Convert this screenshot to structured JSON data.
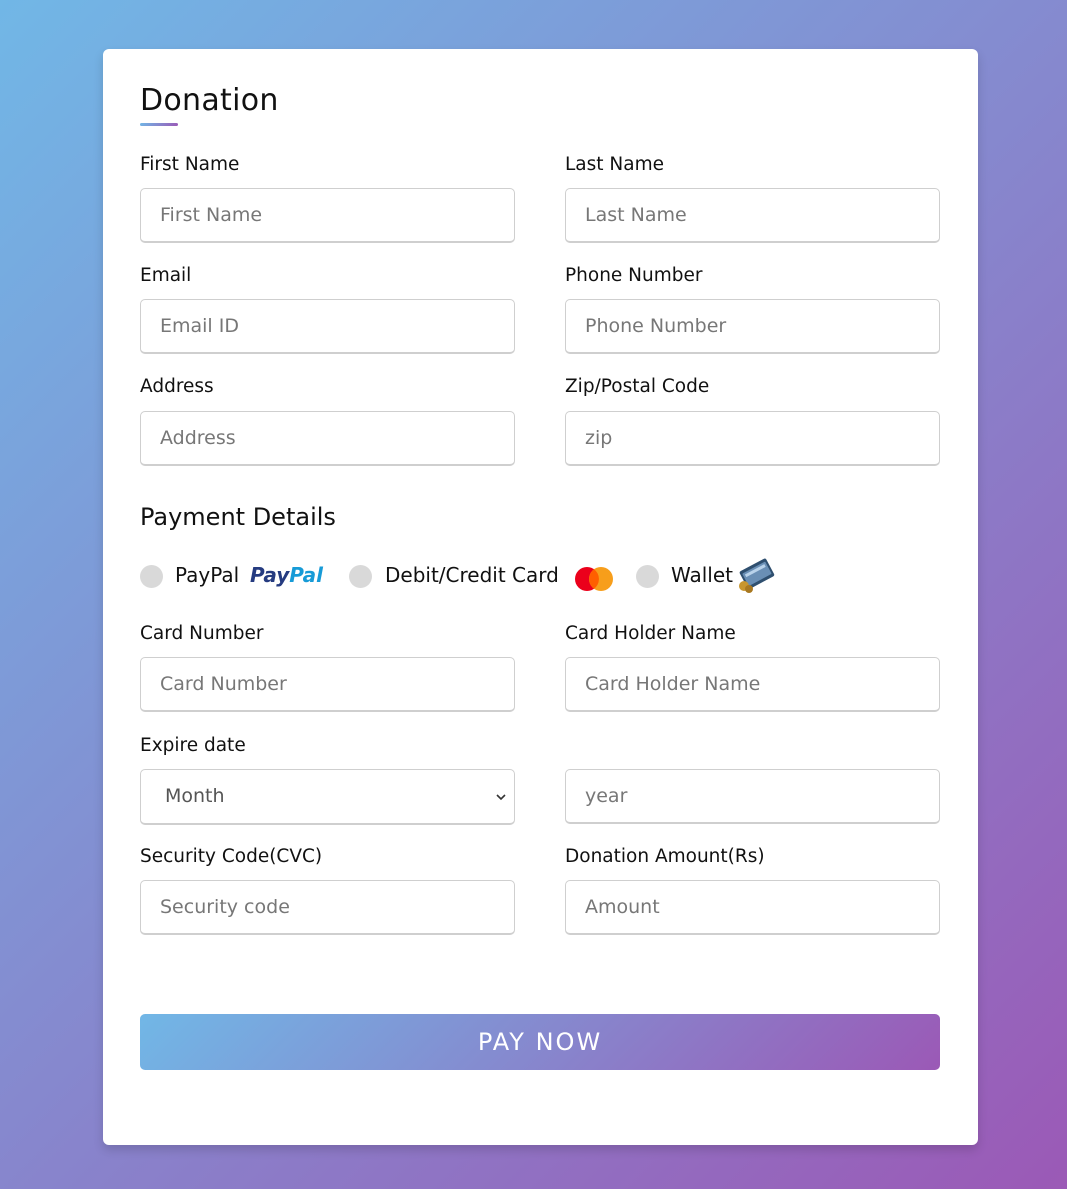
{
  "form": {
    "title": "Donation",
    "first_name": {
      "label": "First Name",
      "placeholder": "First Name"
    },
    "last_name": {
      "label": "Last Name",
      "placeholder": "Last Name"
    },
    "email": {
      "label": "Email",
      "placeholder": "Email ID"
    },
    "phone": {
      "label": "Phone Number",
      "placeholder": "Phone Number"
    },
    "address": {
      "label": "Address",
      "placeholder": "Address"
    },
    "zip": {
      "label": "Zip/Postal Code",
      "placeholder": "zip"
    }
  },
  "payment": {
    "title": "Payment Details",
    "methods": [
      {
        "label": "PayPal",
        "icon": "paypal-logo",
        "logo_text": "PayPal"
      },
      {
        "label": "Debit/Credit Card",
        "icon": "mastercard-logo"
      },
      {
        "label": "Wallet",
        "icon": "wallet-icon"
      }
    ],
    "card_number": {
      "label": "Card Number",
      "placeholder": "Card Number"
    },
    "card_holder": {
      "label": "Card Holder Name",
      "placeholder": "Card Holder Name"
    },
    "expire": {
      "label": "Expire date",
      "month_selected": "Month",
      "year_placeholder": "year"
    },
    "cvc": {
      "label": "Security Code(CVC)",
      "placeholder": "Security code"
    },
    "amount": {
      "label": "Donation Amount(Rs)",
      "placeholder": "Amount"
    }
  },
  "submit_label": "PAY NOW",
  "colors": {
    "gradient_start": "#71b7e6",
    "gradient_end": "#9b59b6",
    "paypal_dark": "#253b80",
    "paypal_light": "#179bd7"
  }
}
